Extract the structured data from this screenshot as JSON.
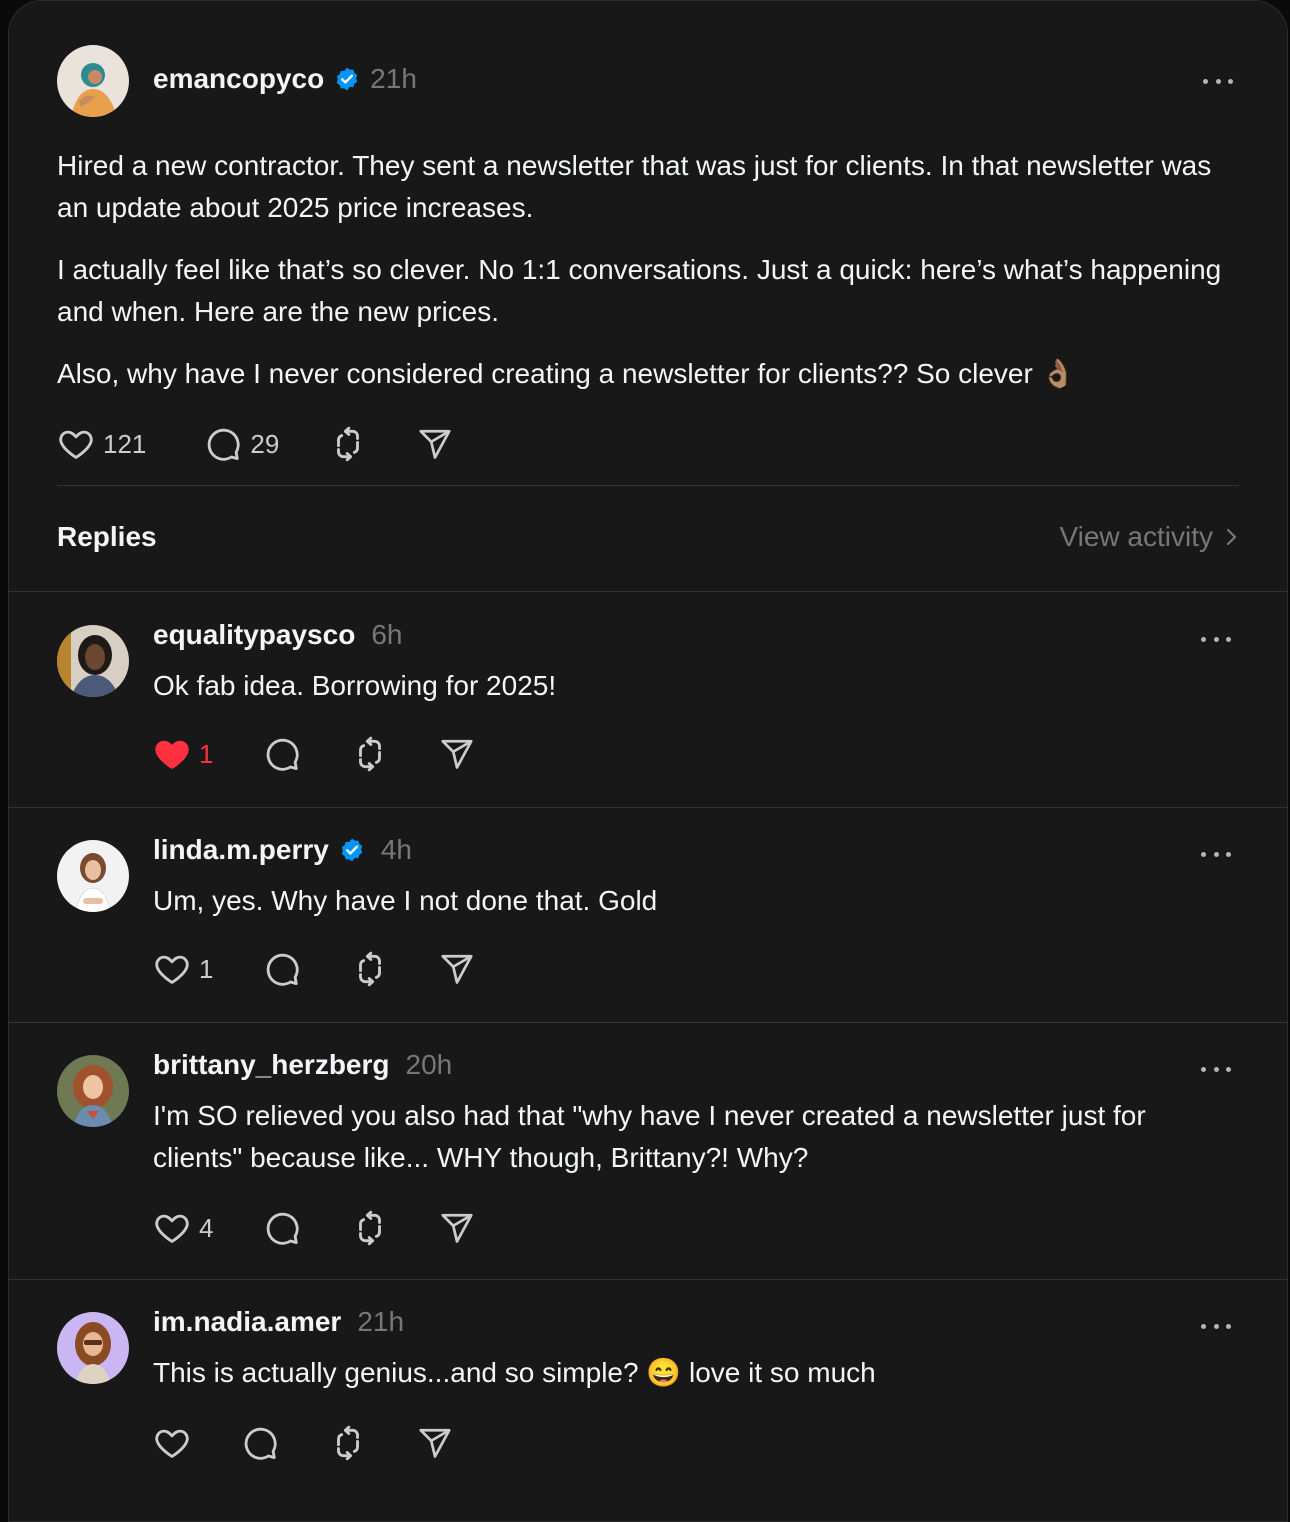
{
  "post": {
    "username": "emancopyco",
    "verified": true,
    "time": "21h",
    "paragraphs": [
      "Hired a new contractor. They sent a newsletter that was just for clients. In that newsletter was an update about 2025 price increases.",
      "I actually feel like that’s so clever. No 1:1 conversations. Just a quick: here’s what’s happening and when. Here are the new prices.",
      "Also, why have I never considered creating a newsletter for clients?? So clever 👌🏽"
    ],
    "likes": "121",
    "comments": "29"
  },
  "replies_section": {
    "title": "Replies",
    "view_activity": "View activity"
  },
  "replies": [
    {
      "username": "equalitypaysco",
      "verified": false,
      "time": "6h",
      "text": "Ok fab idea. Borrowing for 2025!",
      "likes": "1",
      "liked": true
    },
    {
      "username": "linda.m.perry",
      "verified": true,
      "time": "4h",
      "text": "Um, yes. Why have I not done that. Gold",
      "likes": "1",
      "liked": false
    },
    {
      "username": "brittany_herzberg",
      "verified": false,
      "time": "20h",
      "text": "I'm SO relieved you also had that \"why have I never created a newsletter just for clients\" because like... WHY though, Brittany?! Why?",
      "likes": "4",
      "liked": false
    },
    {
      "username": "im.nadia.amer",
      "verified": false,
      "time": "21h",
      "text": "This is actually genius...and so simple? 😄 love it so much",
      "likes": "",
      "liked": false
    }
  ],
  "colors": {
    "background": "#181818",
    "text": "#f3f5f7",
    "muted": "#777777",
    "verified": "#0095f6",
    "liked": "#ff3040"
  },
  "icons": [
    "heart-icon",
    "comment-icon",
    "repost-icon",
    "share-icon",
    "more-icon",
    "verified-icon",
    "chevron-right-icon"
  ]
}
